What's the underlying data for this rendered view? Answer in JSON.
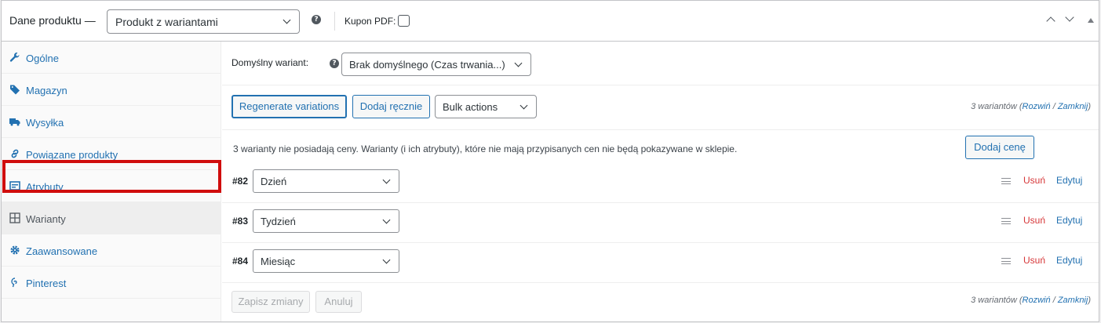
{
  "header": {
    "title": "Dane produktu —",
    "product_type": "Produkt z wariantami",
    "coupon_label": "Kupon PDF:"
  },
  "sidebar": {
    "items": [
      {
        "label": "Ogólne",
        "icon": "wrench-icon"
      },
      {
        "label": "Magazyn",
        "icon": "tag-icon"
      },
      {
        "label": "Wysyłka",
        "icon": "truck-icon"
      },
      {
        "label": "Powiązane produkty",
        "icon": "link-icon"
      },
      {
        "label": "Atrybuty",
        "icon": "list-icon"
      },
      {
        "label": "Warianty",
        "icon": "grid-icon",
        "active": true
      },
      {
        "label": "Zaawansowane",
        "icon": "gear-icon"
      },
      {
        "label": "Pinterest",
        "icon": "pinterest-icon"
      }
    ]
  },
  "main": {
    "default_variant_label": "Domyślny wariant:",
    "default_variant_value": "Brak domyślnego (Czas trwania...)",
    "toolbar": {
      "regenerate_label": "Regenerate variations",
      "add_manual_label": "Dodaj ręcznie",
      "bulk_actions_value": "Bulk actions"
    },
    "count": {
      "text": "3 wariantów",
      "expand": "Rozwiń",
      "separator": "/",
      "collapse": "Zamknij"
    },
    "notice": "3 warianty nie posiadają ceny. Warianty (i ich atrybuty), które nie mają przypisanych cen nie będą pokazywane w sklepie.",
    "add_price_label": "Dodaj cenę",
    "variations": [
      {
        "id": "#82",
        "value": "Dzień",
        "remove": "Usuń",
        "edit": "Edytuj"
      },
      {
        "id": "#83",
        "value": "Tydzień",
        "remove": "Usuń",
        "edit": "Edytuj"
      },
      {
        "id": "#84",
        "value": "Miesiąc",
        "remove": "Usuń",
        "edit": "Edytuj"
      }
    ],
    "footer": {
      "save_label": "Zapisz zmiany",
      "cancel_label": "Anuluj"
    }
  },
  "colors": {
    "accent": "#2271b1",
    "danger": "#d63638",
    "highlight": "#d00d0d"
  }
}
